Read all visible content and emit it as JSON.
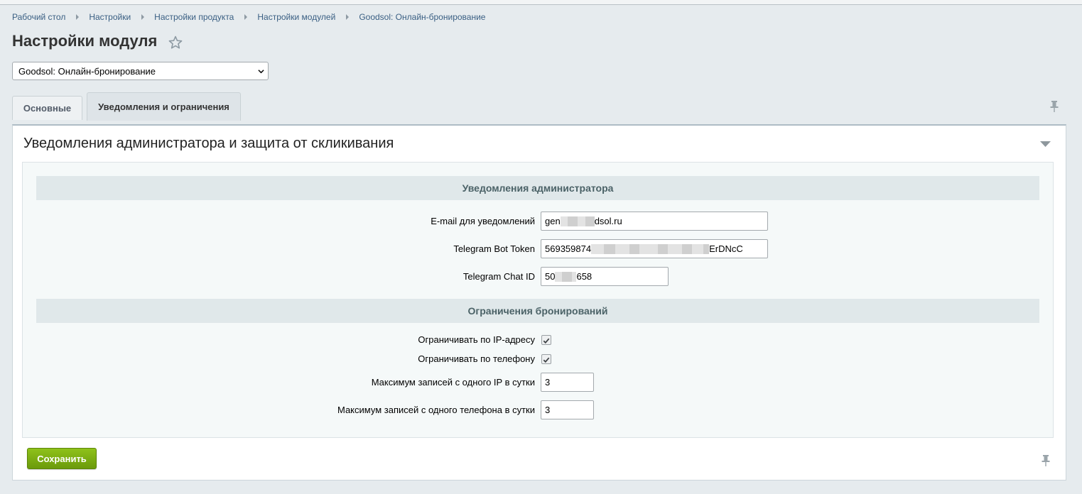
{
  "breadcrumb": [
    "Рабочий стол",
    "Настройки",
    "Настройки продукта",
    "Настройки модулей",
    "Goodsol: Онлайн-бронирование"
  ],
  "page": {
    "title": "Настройки модуля"
  },
  "module_select": {
    "value": "Goodsol: Онлайн-бронирование"
  },
  "tabs": {
    "main": "Основные",
    "notifications": "Уведомления и ограничения"
  },
  "section": {
    "title": "Уведомления администратора и защита от скликивания"
  },
  "admin_notifications": {
    "heading": "Уведомления администратора",
    "email_label": "E-mail для уведомлений",
    "email_prefix": "gen",
    "email_suffix": "dsol.ru",
    "token_label": "Telegram Bot Token",
    "token_prefix": "569359874",
    "token_suffix": "ErDNcC",
    "chat_label": "Telegram Chat ID",
    "chat_prefix": "50",
    "chat_suffix": "658"
  },
  "booking_limits": {
    "heading": "Ограничения бронирований",
    "ip_limit_label": "Ограничивать по IP-адресу",
    "ip_limit_checked": true,
    "phone_limit_label": "Ограничивать по телефону",
    "phone_limit_checked": true,
    "max_ip_label": "Максимум записей с одного IP в сутки",
    "max_ip_value": "3",
    "max_phone_label": "Максимум записей с одного телефона в сутки",
    "max_phone_value": "3"
  },
  "buttons": {
    "save": "Сохранить"
  },
  "icons": {
    "star": "star-icon",
    "pin": "pin-icon",
    "collapse": "chevron-down-icon",
    "check": "checkmark-icon",
    "select_arrow": "chevron-down-icon"
  },
  "colors": {
    "save_button": "#7cad12",
    "link": "#3a5f83",
    "heading_bar": "#e0e8ea"
  }
}
